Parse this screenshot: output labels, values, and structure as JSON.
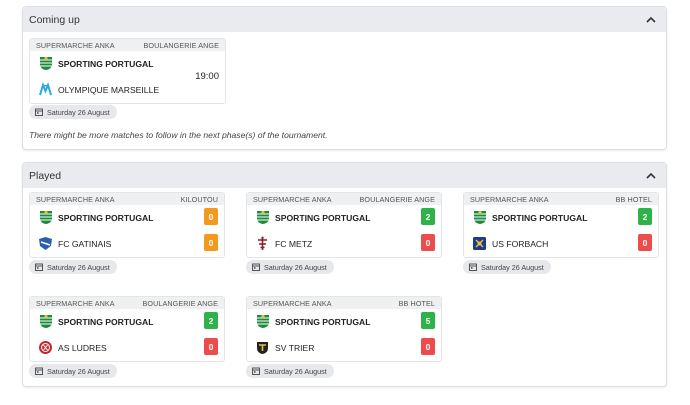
{
  "colors": {
    "win": "#2db34a",
    "draw": "#f39a1e",
    "loss": "#ec4c4c"
  },
  "coming_up": {
    "title": "Coming up",
    "note": "There might be more matches to follow in the next phase(s) of the tournament.",
    "match": {
      "left_label": "SUPERMARCHE ANKA",
      "right_label": "BOULANGERIE ANGE",
      "home": "SPORTING PORTUGAL",
      "away": "OLYMPIQUE MARSEILLE",
      "time": "19:00",
      "date": "Saturday 26 August"
    }
  },
  "played": {
    "title": "Played",
    "matches": [
      {
        "left_label": "SUPERMARCHE ANKA",
        "right_label": "KILOUTOU",
        "home": "SPORTING PORTUGAL",
        "away": "FC GATINAIS",
        "home_score": "0",
        "away_score": "0",
        "home_status": "draw",
        "away_status": "draw",
        "date": "Saturday 26 August",
        "away_logo": "gatinais-logo"
      },
      {
        "left_label": "SUPERMARCHE ANKA",
        "right_label": "BOULANGERIE ANGE",
        "home": "SPORTING PORTUGAL",
        "away": "FC METZ",
        "home_score": "2",
        "away_score": "0",
        "home_status": "win",
        "away_status": "loss",
        "date": "Saturday 26 August",
        "away_logo": "metz-logo"
      },
      {
        "left_label": "SUPERMARCHE ANKA",
        "right_label": "BB HOTEL",
        "home": "SPORTING PORTUGAL",
        "away": "US FORBACH",
        "home_score": "2",
        "away_score": "0",
        "home_status": "win",
        "away_status": "loss",
        "date": "Saturday 26 August",
        "away_logo": "forbach-logo"
      },
      {
        "left_label": "SUPERMARCHE ANKA",
        "right_label": "BOULANGERIE ANGE",
        "home": "SPORTING PORTUGAL",
        "away": "AS LUDRES",
        "home_score": "2",
        "away_score": "0",
        "home_status": "win",
        "away_status": "loss",
        "date": "Saturday 26 August",
        "away_logo": "ludres-logo"
      },
      {
        "left_label": "SUPERMARCHE ANKA",
        "right_label": "BB HOTEL",
        "home": "SPORTING PORTUGAL",
        "away": "SV TRIER",
        "home_score": "5",
        "away_score": "0",
        "home_status": "win",
        "away_status": "loss",
        "date": "Saturday 26 August",
        "away_logo": "trier-logo"
      }
    ]
  }
}
